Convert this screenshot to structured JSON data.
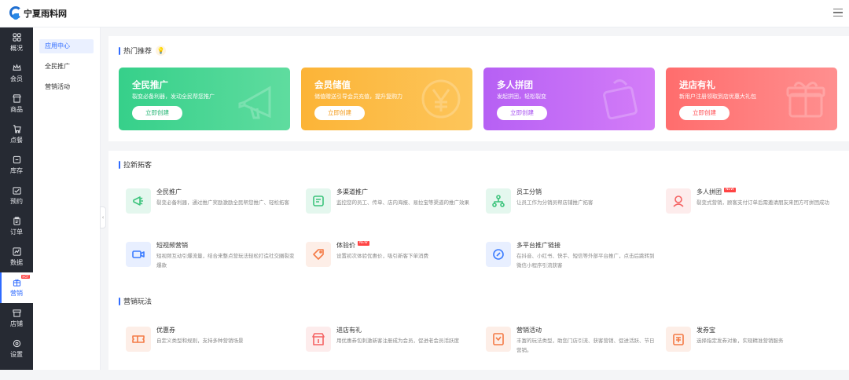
{
  "brand": {
    "name": "宁夏雨料网"
  },
  "sidebar": {
    "items": [
      {
        "label": "概况",
        "icon": "grid-icon"
      },
      {
        "label": "会员",
        "icon": "crown-icon"
      },
      {
        "label": "商品",
        "icon": "store-icon"
      },
      {
        "label": "点餐",
        "icon": "cart-icon"
      },
      {
        "label": "库存",
        "icon": "box-icon"
      },
      {
        "label": "预约",
        "icon": "calendar-check-icon"
      },
      {
        "label": "订单",
        "icon": "clipboard-icon"
      },
      {
        "label": "数据",
        "icon": "chart-icon"
      },
      {
        "label": "营销",
        "icon": "gift-icon",
        "badge": "HOT",
        "active": true
      },
      {
        "label": "店铺",
        "icon": "shop-icon"
      },
      {
        "label": "设置",
        "icon": "settings-icon"
      }
    ]
  },
  "subnav": {
    "items": [
      {
        "label": "应用中心",
        "active": true
      },
      {
        "label": "全民推广"
      },
      {
        "label": "营销活动"
      }
    ]
  },
  "hot": {
    "title": "热门推荐",
    "cards": [
      {
        "title": "全民推广",
        "desc": "裂变必备利器，发动全民帮您推广",
        "button": "立即创建",
        "icon": "megaphone-icon"
      },
      {
        "title": "会员储值",
        "desc": "储值赠送引导会员充值，提升复购力",
        "button": "立即创建",
        "icon": "yen-icon"
      },
      {
        "title": "多人拼团",
        "desc": "发起拼团，轻松裂变",
        "button": "立即创建",
        "icon": "group-buy-icon"
      },
      {
        "title": "进店有礼",
        "desc": "新用户注册领取到店优惠大礼包",
        "button": "立即创建",
        "icon": "gift-box-icon"
      }
    ]
  },
  "acquire": {
    "title": "拉新拓客",
    "items": [
      {
        "name": "全民推广",
        "desc": "裂变必备利器，通过推广奖励激励全民帮您推广、轻松拓客",
        "icon": "megaphone-icon",
        "theme": "green"
      },
      {
        "name": "多渠道推广",
        "desc": "监控您的员工、传单、店内海报、易拉宝等渠道的推广效果",
        "icon": "channel-icon",
        "theme": "green"
      },
      {
        "name": "员工分销",
        "desc": "让员工作为分销员帮店铺推广拓客",
        "icon": "network-icon",
        "theme": "green"
      },
      {
        "name": "多人拼团",
        "desc": "裂变式营销，顾客支付订单后需邀请朋友来团方可拼团成功",
        "icon": "group-icon",
        "theme": "red",
        "badge": "NEW"
      },
      {
        "name": "短视频营销",
        "desc": "短视频互动引爆流量，结合来整点营玩法轻松打造社交圈裂变爆款",
        "icon": "video-icon",
        "theme": "blue"
      },
      {
        "name": "体验价",
        "desc": "设置初次体验优惠价，吸引新客下单消费",
        "icon": "tag-icon",
        "theme": "orange",
        "badge": "NEW"
      },
      {
        "name": "多平台推广链接",
        "desc": "在抖音、小红书、快手、短信等外部平台推广，点击后跳转到微信小程序引流获客",
        "icon": "link-icon",
        "theme": "blue"
      }
    ]
  },
  "marketing": {
    "title": "营销玩法",
    "items": [
      {
        "name": "优惠券",
        "desc": "自定义类型和规则，支持多种营销场景",
        "icon": "coupon-icon",
        "theme": "orange"
      },
      {
        "name": "进店有礼",
        "desc": "用优惠券包刺激新客注册成为会员，促进老会员活跃度",
        "icon": "store-gift-icon",
        "theme": "red"
      },
      {
        "name": "营销活动",
        "desc": "丰富的玩法类型，助您门店引流、获客营销、促进活跃、节日营销。",
        "icon": "activity-icon",
        "theme": "orange"
      },
      {
        "name": "发券宝",
        "desc": "选择指定发券对象，实现精准营销服务",
        "icon": "voucher-icon",
        "theme": "orange"
      }
    ]
  },
  "colors": {
    "primary": "#2f6bff",
    "sidebar": "#262a33"
  }
}
